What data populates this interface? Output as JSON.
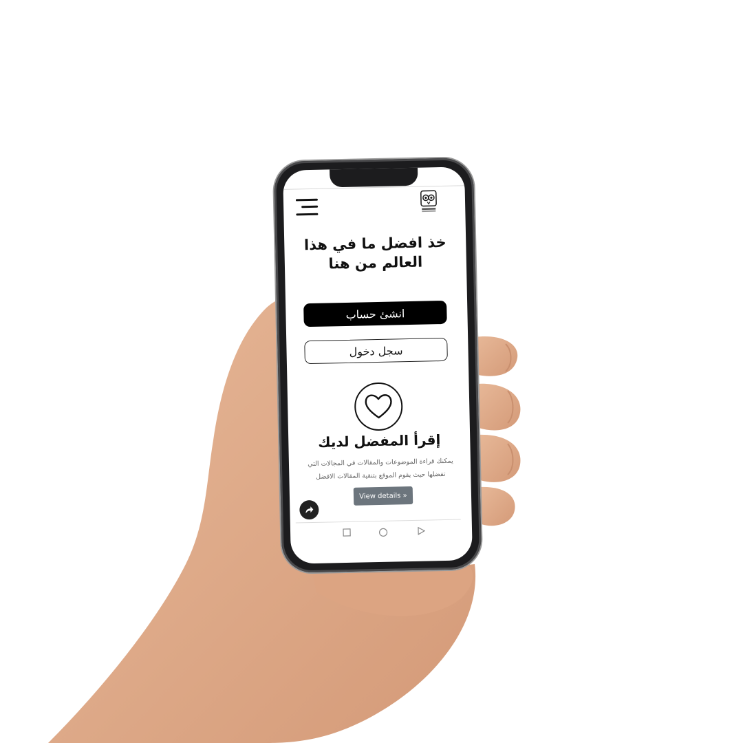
{
  "app": {
    "headline": "خذ افضل ما في هذا العالم من هنا",
    "create_account_label": "انشئ حساب",
    "login_label": "سجل دخول",
    "section_title": "إقرأ المفضل لديك",
    "section_description": "يمكنك قراءة الموضوعات والمقالات في المجالات التي تفضلها حيث يقوم الموقع بتنقية المقالات الافضل",
    "details_button_label": "View details »"
  },
  "icons": {
    "menu": "hamburger-menu-icon",
    "logo": "owl-logo-icon",
    "feature": "heart-icon",
    "share": "share-icon",
    "nav_recent": "square-recent-icon",
    "nav_home": "circle-home-icon",
    "nav_back": "triangle-back-icon"
  },
  "colors": {
    "primary_button": "#000000",
    "details_button": "#6c757d",
    "text": "#111111",
    "muted_text": "#666666"
  }
}
